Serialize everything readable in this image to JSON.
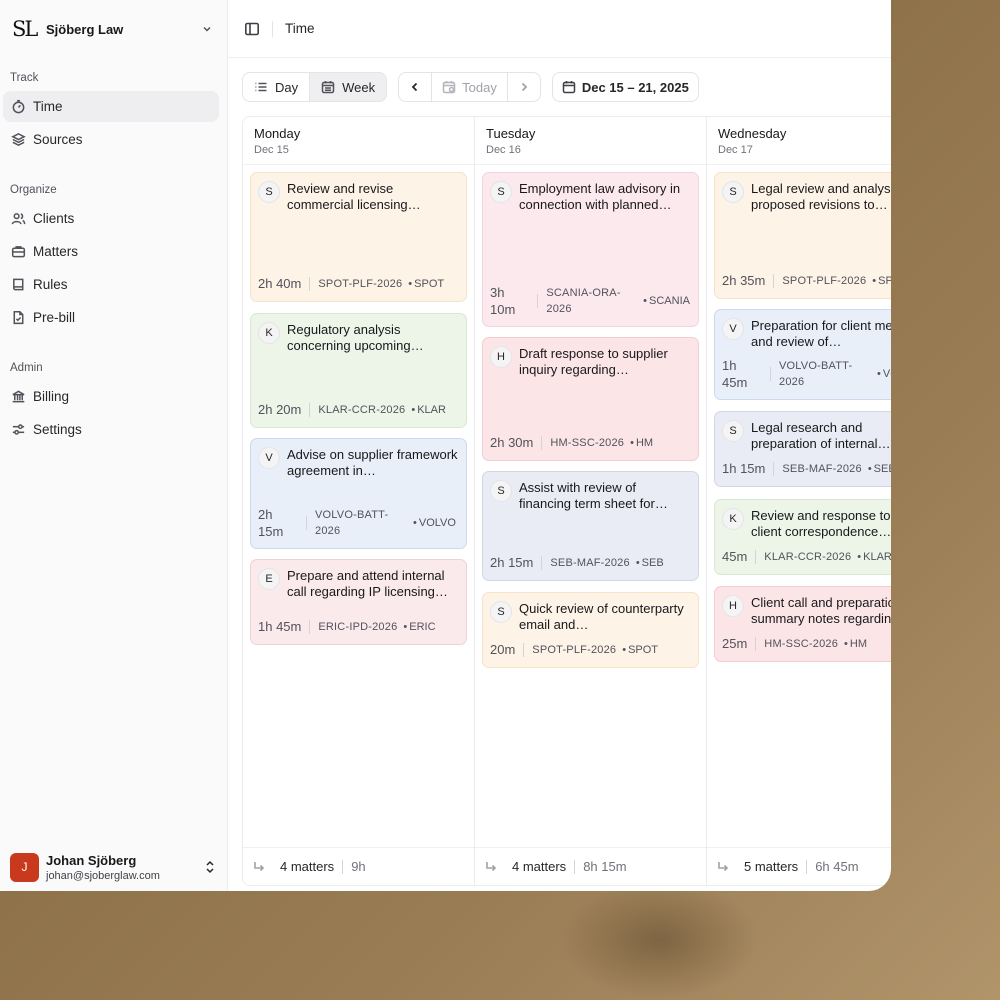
{
  "org": {
    "logo": "SL",
    "name": "Sjöberg Law"
  },
  "nav": {
    "sections": [
      {
        "label": "Track",
        "items": [
          {
            "label": "Time",
            "icon": "timer-icon",
            "active": true
          },
          {
            "label": "Sources",
            "icon": "layers-icon"
          }
        ]
      },
      {
        "label": "Organize",
        "items": [
          {
            "label": "Clients",
            "icon": "users-icon"
          },
          {
            "label": "Matters",
            "icon": "briefcase-icon"
          },
          {
            "label": "Rules",
            "icon": "book-icon"
          },
          {
            "label": "Pre-bill",
            "icon": "file-check-icon"
          }
        ]
      },
      {
        "label": "Admin",
        "items": [
          {
            "label": "Billing",
            "icon": "bank-icon"
          },
          {
            "label": "Settings",
            "icon": "sliders-icon"
          }
        ]
      }
    ]
  },
  "user": {
    "initial": "J",
    "name": "Johan Sjöberg",
    "email": "johan@sjoberglaw.com"
  },
  "header": {
    "crumb": "Time"
  },
  "toolbar": {
    "day": "Day",
    "week": "Week",
    "today": "Today",
    "range": "Dec 15 – 21, 2025"
  },
  "columns": [
    {
      "day": "Monday",
      "date": "Dec 15",
      "entries": [
        {
          "badge": "S",
          "title": "Review and revise commercial licensing…",
          "duration": "2h 40m",
          "code": "SPOT-PLF-2026",
          "client": "SPOT"
        },
        {
          "badge": "K",
          "title": "Regulatory analysis concerning upcoming…",
          "duration": "2h 20m",
          "code": "KLAR-CCR-2026",
          "client": "KLAR"
        },
        {
          "badge": "V",
          "title": "Advise on supplier framework agreement in…",
          "duration": "2h 15m",
          "code": "VOLVO-BATT-2026",
          "client": "VOLVO"
        },
        {
          "badge": "E",
          "title": "Prepare and attend internal call regarding IP licensing…",
          "duration": "1h 45m",
          "code": "ERIC-IPD-2026",
          "client": "ERIC"
        }
      ],
      "footer": {
        "matters": "4 matters",
        "hours": "9h"
      }
    },
    {
      "day": "Tuesday",
      "date": "Dec 16",
      "entries": [
        {
          "badge": "S",
          "title": "Employment law advisory in connection with planned…",
          "duration": "3h 10m",
          "code": "SCANIA-ORA-2026",
          "client": "SCANIA"
        },
        {
          "badge": "H",
          "title": "Draft response to supplier inquiry regarding…",
          "duration": "2h 30m",
          "code": "HM-SSC-2026",
          "client": "HM"
        },
        {
          "badge": "S",
          "title": "Assist with review of financing term sheet for…",
          "duration": "2h 15m",
          "code": "SEB-MAF-2026",
          "client": "SEB"
        },
        {
          "badge": "S",
          "title": "Quick review of counterparty email and…",
          "duration": "20m",
          "code": "SPOT-PLF-2026",
          "client": "SPOT"
        }
      ],
      "footer": {
        "matters": "4 matters",
        "hours": "8h 15m"
      }
    },
    {
      "day": "Wednesday",
      "date": "Dec 17",
      "entries": [
        {
          "badge": "S",
          "title": "Legal review and analysis of proposed revisions to…",
          "duration": "2h 35m",
          "code": "SPOT-PLF-2026",
          "client": "SPOT"
        },
        {
          "badge": "V",
          "title": "Preparation for client meeting and review of…",
          "duration": "1h 45m",
          "code": "VOLVO-BATT-2026",
          "client": "VOLVO"
        },
        {
          "badge": "S",
          "title": "Legal research and preparation of internal…",
          "duration": "1h 15m",
          "code": "SEB-MAF-2026",
          "client": "SEB"
        },
        {
          "badge": "K",
          "title": "Review and response to client correspondence…",
          "duration": "45m",
          "code": "KLAR-CCR-2026",
          "client": "KLAR"
        },
        {
          "badge": "H",
          "title": "Client call and preparation of summary notes regarding…",
          "duration": "25m",
          "code": "HM-SSC-2026",
          "client": "HM"
        }
      ],
      "footer": {
        "matters": "5 matters",
        "hours": "6h 45m"
      }
    }
  ]
}
